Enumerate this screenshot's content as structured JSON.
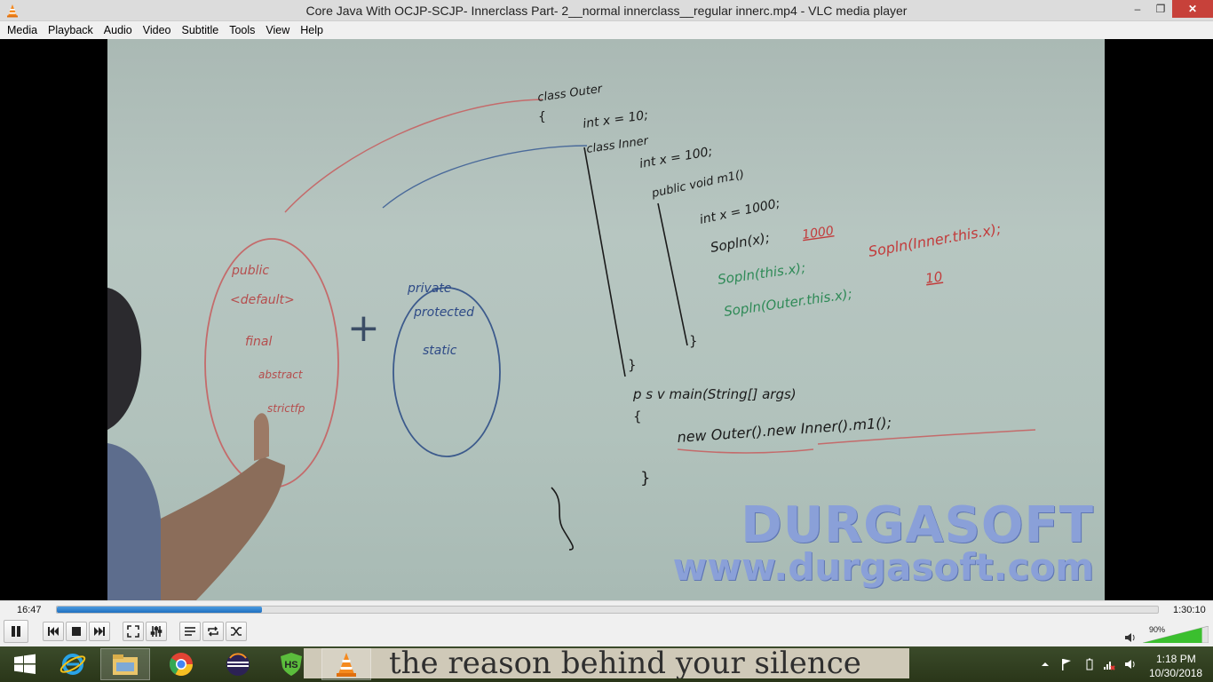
{
  "window": {
    "title": "Core Java With OCJP-SCJP- Innerclass  Part- 2__normal innerclass__regular innerc.mp4 - VLC media player",
    "buttons": {
      "minimize": "–",
      "maximize": "❐",
      "close": "✕"
    }
  },
  "menubar": {
    "items": [
      "Media",
      "Playback",
      "Audio",
      "Video",
      "Subtitle",
      "Tools",
      "View",
      "Help"
    ]
  },
  "video": {
    "watermark_line1": "DURGASOFT",
    "watermark_line2": "www.durgasoft.com",
    "board": {
      "code": [
        "class Outer",
        "{",
        "int x = 10;",
        "class Inner",
        "int x = 100;",
        "public void m1()",
        "int x = 1000;",
        "Sopln(x);",
        "1000",
        "Sopln(this.x);",
        "Sopln(Inner.this.x);",
        "Sopln(Outer.this.x);",
        "10",
        "}",
        "}",
        "p s v main(String[] args)",
        "{",
        "new Outer().new Inner().m1();",
        "}"
      ],
      "left_oval": [
        "public",
        "<default>",
        "final",
        "abstract",
        "strictfp"
      ],
      "plus": "+",
      "right_oval": [
        "private",
        "protected",
        "static"
      ]
    }
  },
  "controls": {
    "time_elapsed": "16:47",
    "time_total": "1:30:10",
    "progress": 0.186,
    "volume_percent": "90%",
    "volume": 0.9
  },
  "taskbar": {
    "background_text": "the reason behind your silence",
    "apps": [
      "file-explorer",
      "chrome",
      "eclipse",
      "hotspot-shield",
      "vlc"
    ],
    "clock_time": "1:18 PM",
    "clock_date": "10/30/2018"
  },
  "colors": {
    "accent": "#1e6fc0",
    "close": "#c7413a",
    "watermark": "#8aa0d8"
  }
}
